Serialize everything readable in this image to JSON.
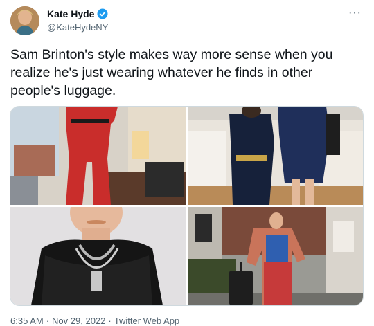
{
  "author": {
    "display_name": "Kate Hyde",
    "handle": "@KateHydeNY",
    "avatar_icon": "profile-photo",
    "verified": true,
    "verified_color": "#1d9bf0"
  },
  "menu_icon": "more-dots-icon",
  "more_label": "···",
  "tweet": {
    "text": "Sam Brinton's style makes way more sense when you realize he's just wearing whatever he finds in other people's luggage."
  },
  "media": {
    "images": [
      {
        "name": "photo-red-jumpsuit"
      },
      {
        "name": "photo-navy-uniform"
      },
      {
        "name": "photo-lace-top-necklace"
      },
      {
        "name": "photo-suitcase-street"
      }
    ]
  },
  "meta": {
    "time": "6:35 AM",
    "date": "Nov 29, 2022",
    "source": "Twitter Web App",
    "separator": "·"
  }
}
